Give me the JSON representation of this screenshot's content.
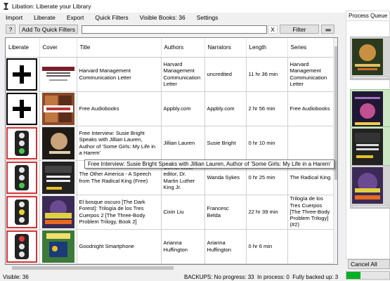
{
  "window": {
    "title": "Libation: Liberate your Library"
  },
  "menu": {
    "import": "Import",
    "liberate": "Liberate",
    "export": "Export",
    "quick_filters": "Quick Filters",
    "visible_books": "Visible Books: 36",
    "settings": "Settings"
  },
  "toolbar": {
    "help": "?",
    "add_quick_filter": "Add To Quick Filters",
    "filter_value": "",
    "clear": "X",
    "filter": "Filter",
    "more": "»»"
  },
  "grid": {
    "columns": [
      "Liberate",
      "Cover",
      "Title",
      "Authors",
      "Narrators",
      "Length",
      "Series"
    ],
    "rows": [
      {
        "status": "plus",
        "title": "Harvard Management Communication Letter",
        "authors": "Harvard Management Communication Letter",
        "narrators": "uncredited",
        "length": "11 hr 36 min",
        "series": "Harvard Management Communication Letter",
        "cover": "harvard"
      },
      {
        "status": "plus",
        "title": "Free Audiobooks",
        "authors": "Appbly.com",
        "narrators": "Appbly.com",
        "length": "2 hr 56 min",
        "series": "Free Audiobooks",
        "cover": "free"
      },
      {
        "status": "green",
        "title": "Free Interview: Susie Bright Speaks with Jillian Lauren, Author of 'Some Girls: My Life in a Harem'",
        "authors": "Jillian Lauren",
        "narrators": "Susie Bright",
        "length": "0 hr 10 min",
        "series": "",
        "cover": "susie"
      },
      {
        "status": "green",
        "title": "The Other America - A Speech from The Radical King (Free)",
        "authors": "Cornel West - editor, Dr. Martin Luther King Jr.",
        "narrators": "Wanda Sykes",
        "length": "0 hr 25 min",
        "series": "The Radical King",
        "cover": "america"
      },
      {
        "status": "yellow",
        "title": "El bosque oscuro [The Dark Forest]: Trilogía de los Tres Cuerpos 2 [The Three-Body Problem Trilogy, Book 2]",
        "authors": "Cixin Liu",
        "narrators": "Francesc Belda",
        "length": "22 hr 39 min",
        "series": "Trilogía de los Tres Cuerpos [The Three-Body Problem Trilogy] (#2)",
        "cover": "bosque"
      },
      {
        "status": "red",
        "title": "Goodnight Smartphone",
        "authors": "Arianna Huffington",
        "narrators": "Arianna Huffington",
        "length": "0 hr 6 min",
        "series": "",
        "cover": "goodnight"
      }
    ]
  },
  "tooltip": "Free Interview: Susie Bright Speaks with Jillian Lauren, Author of 'Some Girls: My Life in a Harem'",
  "status": {
    "visible": "Visible: 36",
    "backups": "BACKUPS: No progress: 33  In process: 0  Fully backed up: 3"
  },
  "queue": {
    "tab": "Process Queue",
    "cancel_all": "Cancel All",
    "progress_fraction": 0.32
  },
  "colors": {
    "red_border": "#d53333",
    "progress": "#06b025"
  }
}
